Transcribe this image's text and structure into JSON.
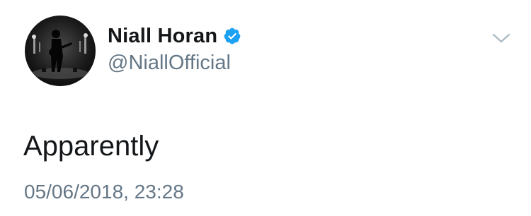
{
  "tweet": {
    "author": {
      "display_name": "Niall Horan",
      "handle": "@NiallOfficial",
      "verified": true,
      "avatar_icon": "avatar-concert-guitarist"
    },
    "text": "Apparently",
    "timestamp": "05/06/2018, 23:28",
    "menu_icon": "chevron-down-icon"
  },
  "colors": {
    "verified_badge": "#1da1f2",
    "secondary_text": "#657786",
    "primary_text": "#14171a"
  }
}
